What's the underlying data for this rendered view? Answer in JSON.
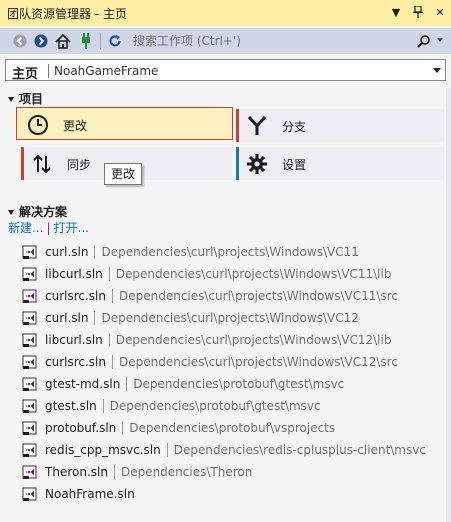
{
  "window": {
    "title": "团队资源管理器 - 主页",
    "title_bg": "#ffefa5",
    "buttons": [
      {
        "name": "dropdown-icon",
        "glyph": "▼"
      },
      {
        "name": "pin-icon",
        "glyph": "ᴨ"
      },
      {
        "name": "close-icon",
        "glyph": "✕"
      }
    ]
  },
  "toolbar": {
    "search_placeholder": "搜索工作项 (Ctrl+')",
    "icons": [
      "back-icon",
      "forward-icon",
      "home-icon",
      "connect-icon",
      "refresh-icon"
    ]
  },
  "navbar": {
    "title": "主页",
    "subtitle": "NoahGameFrame"
  },
  "project": {
    "header": "项目",
    "tiles": [
      {
        "label": "更改",
        "icon": "clock-icon",
        "accent": "#c4432e",
        "selected": true
      },
      {
        "label": "分支",
        "icon": "branch-icon",
        "accent": "#c4432e",
        "selected": false
      },
      {
        "label": "同步",
        "icon": "sync-icon",
        "accent": "#c4432e",
        "selected": false
      },
      {
        "label": "设置",
        "icon": "gear-icon",
        "accent": "#1e7aa8",
        "selected": false
      }
    ],
    "tooltip": "更改"
  },
  "solutions": {
    "header": "解决方案",
    "new_link": "新建...",
    "open_link": "打开...",
    "items": [
      {
        "name": "curl.sln",
        "path": "Dependencies\\curl\\projects\\Windows\\VC11"
      },
      {
        "name": "libcurl.sln",
        "path": "Dependencies\\curl\\projects\\Windows\\VC11\\lib"
      },
      {
        "name": "curlsrc.sln",
        "path": "Dependencies\\curl\\projects\\Windows\\VC11\\src"
      },
      {
        "name": "curl.sln",
        "path": "Dependencies\\curl\\projects\\Windows\\VC12"
      },
      {
        "name": "libcurl.sln",
        "path": "Dependencies\\curl\\projects\\Windows\\VC12\\lib"
      },
      {
        "name": "curlsrc.sln",
        "path": "Dependencies\\curl\\projects\\Windows\\VC12\\src"
      },
      {
        "name": "gtest-md.sln",
        "path": "Dependencies\\protobuf\\gtest\\msvc"
      },
      {
        "name": "gtest.sln",
        "path": "Dependencies\\protobuf\\gtest\\msvc"
      },
      {
        "name": "protobuf.sln",
        "path": "Dependencies\\protobuf\\vsprojects"
      },
      {
        "name": "redis_cpp_msvc.sln",
        "path": "Dependencies\\redis-cplusplus-client\\msvc"
      },
      {
        "name": "Theron.sln",
        "path": "Dependencies\\Theron"
      },
      {
        "name": "NoahFrame.sln",
        "path": ""
      }
    ]
  }
}
